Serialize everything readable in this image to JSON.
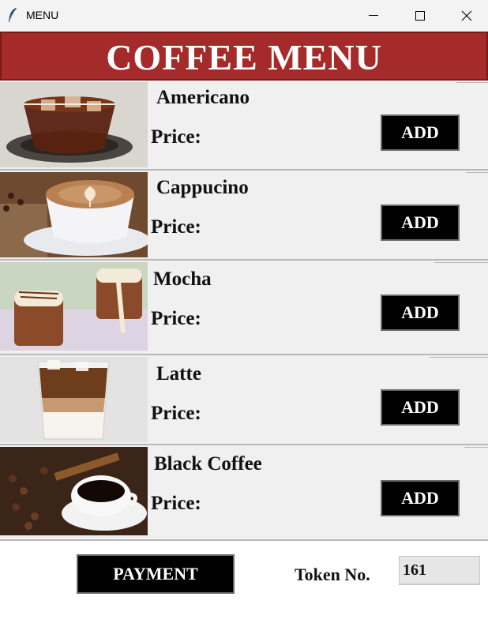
{
  "window": {
    "title": "MENU",
    "controls": [
      "minimize-icon",
      "maximize-icon",
      "close-icon"
    ]
  },
  "header": {
    "title": "COFFEE MENU",
    "color": "#a52a2a"
  },
  "items": [
    {
      "name": "Americano",
      "price_label": "Price:",
      "add_label": "ADD"
    },
    {
      "name": "Cappucino",
      "price_label": "Price:",
      "add_label": "ADD"
    },
    {
      "name": "Mocha",
      "price_label": "Price:",
      "add_label": "ADD"
    },
    {
      "name": "Latte",
      "price_label": "Price:",
      "add_label": "ADD"
    },
    {
      "name": "Black Coffee",
      "price_label": "Price:",
      "add_label": "ADD"
    }
  ],
  "footer": {
    "payment_label": "PAYMENT",
    "token_label": "Token No.",
    "token_value": "161"
  }
}
